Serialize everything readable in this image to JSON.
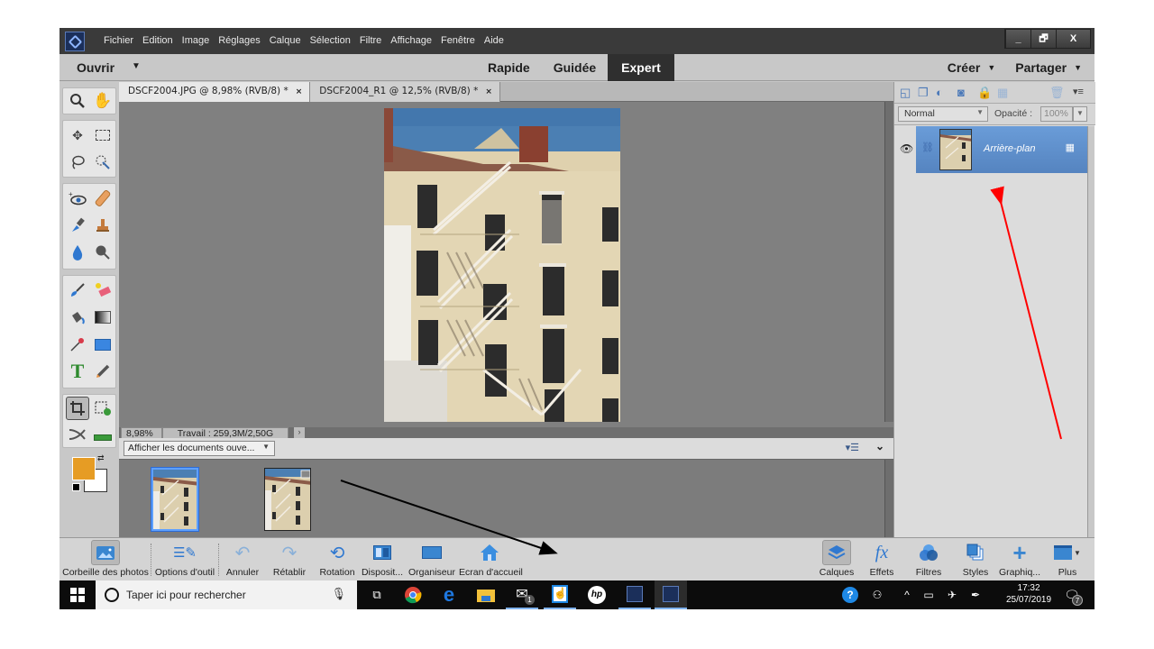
{
  "menubar": {
    "items": [
      "Fichier",
      "Edition",
      "Image",
      "Réglages",
      "Calque",
      "Sélection",
      "Filtre",
      "Affichage",
      "Fenêtre",
      "Aide"
    ],
    "window_controls": {
      "minimize": "_",
      "restore": "🗗",
      "close": "X"
    }
  },
  "modebar": {
    "open_label": "Ouvrir",
    "modes": [
      {
        "label": "Rapide",
        "active": false
      },
      {
        "label": "Guidée",
        "active": false
      },
      {
        "label": "Expert",
        "active": true
      }
    ],
    "create_label": "Créer",
    "share_label": "Partager"
  },
  "tabs": [
    {
      "label": "DSCF2004.JPG @ 8,98% (RVB/8) *",
      "active": true
    },
    {
      "label": "DSCF2004_R1 @ 12,5% (RVB/8) *",
      "active": false
    }
  ],
  "tab_close": "×",
  "toolbox": {
    "tools": [
      "zoom",
      "hand",
      "move",
      "rectangular-marquee",
      "lasso",
      "quick-selection",
      "red-eye",
      "spot-healing",
      "smart-brush",
      "clone-stamp",
      "blur",
      "sponge",
      "brush",
      "eraser",
      "paint-bucket",
      "gradient",
      "eyedropper",
      "rectangle-shape",
      "type",
      "pencil",
      "crop",
      "recompose",
      "content-aware-move",
      "straighten"
    ],
    "active_tool": "crop",
    "foreground_color": "#e69c24",
    "background_color": "#ffffff"
  },
  "status": {
    "zoom": "8,98%",
    "work": "Travail : 259,3M/2,50G"
  },
  "photobin": {
    "show_select": "Afficher les documents ouve...",
    "thumbnails": [
      {
        "name": "DSCF2004.JPG",
        "selected": true
      },
      {
        "name": "DSCF2004_R1",
        "selected": false
      }
    ]
  },
  "layers": {
    "blend_mode": "Normal",
    "opacity_label": "Opacité :",
    "opacity_value": "100%",
    "items": [
      {
        "name": "Arrière-plan",
        "visible": true,
        "locked": true,
        "selected": true
      }
    ]
  },
  "bottom_left": [
    {
      "label": "Corbeille des photos",
      "icon": "photo-bin-icon",
      "selected": true
    },
    {
      "label": "Options d'outil",
      "icon": "tool-options-icon",
      "selected": false
    },
    {
      "label": "Annuler",
      "icon": "undo-icon",
      "selected": false
    },
    {
      "label": "Rétablir",
      "icon": "redo-icon",
      "selected": false
    },
    {
      "label": "Rotation",
      "icon": "rotate-icon",
      "selected": false
    },
    {
      "label": "Disposit...",
      "icon": "layout-icon",
      "selected": false
    },
    {
      "label": "Organiseur",
      "icon": "organizer-icon",
      "selected": false
    },
    {
      "label": "Ecran d'accueil",
      "icon": "home-icon",
      "selected": false
    }
  ],
  "bottom_right": [
    {
      "label": "Calques",
      "icon": "layers-icon",
      "selected": true
    },
    {
      "label": "Effets",
      "icon": "fx-icon",
      "selected": false
    },
    {
      "label": "Filtres",
      "icon": "filters-icon",
      "selected": false
    },
    {
      "label": "Styles",
      "icon": "styles-icon",
      "selected": false
    },
    {
      "label": "Graphiq...",
      "icon": "graphics-icon",
      "selected": false
    },
    {
      "label": "Plus",
      "icon": "more-icon",
      "selected": false
    }
  ],
  "taskbar": {
    "search_placeholder": "Taper ici pour rechercher",
    "apps": [
      "task-view",
      "chrome",
      "edge",
      "file-explorer",
      "mail",
      "touch-app",
      "hp",
      "photoshop-elements",
      "photoshop-elements-editor"
    ],
    "mail_badge": "1",
    "time": "17:32",
    "date": "25/07/2019",
    "notification_count": "7"
  },
  "annotations": {
    "arrow_colors": [
      "#000000",
      "#ff0000"
    ]
  }
}
